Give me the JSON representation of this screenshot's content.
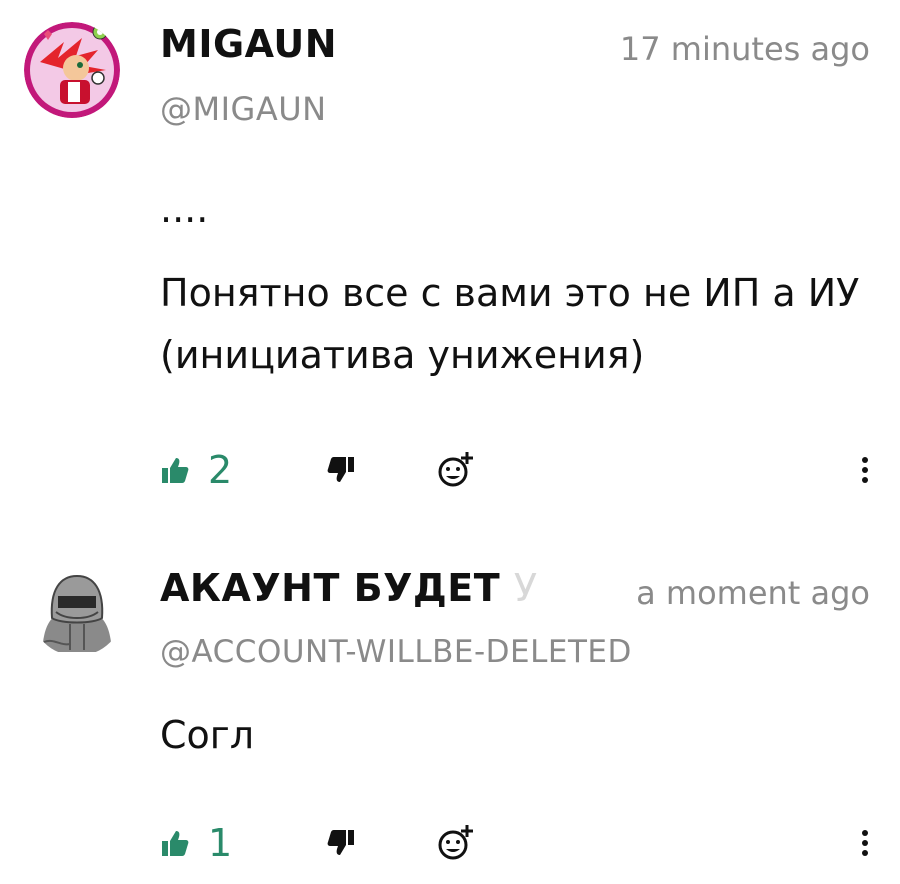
{
  "comments": [
    {
      "author": "MIGAUN",
      "handle": "@MIGAUN",
      "time": "17 minutes ago",
      "lines": [
        "....",
        "Понятно все с вами это не ИП а ИУ (инициатива унижения)"
      ],
      "likes": "2",
      "avatar_icon": "hedgehog-avatar-icon"
    },
    {
      "author": "АКАУНТ БУДЕТ",
      "author_fade": "У",
      "handle": "@ACCOUNT-WILLBE-DELETED",
      "time": "a moment ago",
      "lines": [
        "Согл"
      ],
      "likes": "1",
      "avatar_icon": "hooded-figure-avatar-icon"
    }
  ],
  "icons": {
    "like": "thumbs-up-icon",
    "dislike": "thumbs-down-icon",
    "react": "add-emoji-icon",
    "more": "more-vertical-icon"
  },
  "colors": {
    "accent": "#2a8a6a",
    "muted": "#8a8a8a",
    "text": "#111111"
  }
}
